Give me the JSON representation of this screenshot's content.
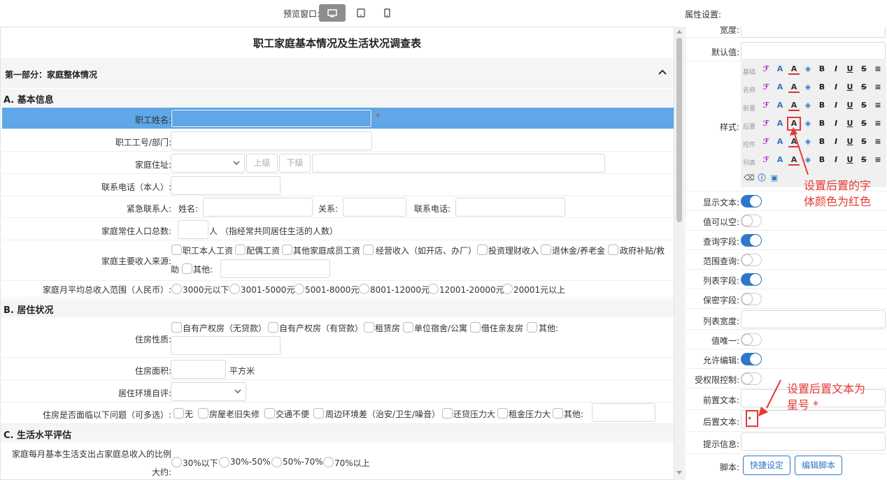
{
  "topbar": {
    "preview_label": "预览窗口:",
    "properties_title": "属性设置:"
  },
  "form": {
    "title": "职工家庭基本情况及生活状况调查表",
    "section1_title": "第一部分：家庭整体情况",
    "groupA": "A. 基本信息",
    "name_label": "职工姓名:",
    "required_mark": "*",
    "id_dept_label": "职工工号/部门:",
    "address_label": "家庭住址:",
    "btn_up": "上级",
    "btn_down": "下级",
    "phone_label": "联系电话（本人）:",
    "emergency_label": "紧急联系人:",
    "em_name": "姓名:",
    "em_relation": "关系:",
    "em_phone": "联系电话:",
    "pop_label": "家庭常住人口总数:",
    "pop_suffix": "人 （指经常共同居住生活的人数）",
    "income_src_label": "家庭主要收入来源:",
    "income_src_options": [
      "职工本人工资",
      "配偶工资",
      "其他家庭成员工资",
      "经营收入（如开店、办厂）",
      "投资理财收入",
      "退休金/养老金",
      "政府补贴/救"
    ],
    "income_src_wrap": "助",
    "income_src_other": "其他:",
    "income_range_label": "家庭月平均总收入范围（人民币）:",
    "income_range_options": [
      "3000元以下",
      "3001-5000元",
      "5001-8000元",
      "8001-12000元",
      "12001-20000元",
      "20001元以上"
    ],
    "groupB": "B. 居住状况",
    "housing_label": "住房性质:",
    "housing_options": [
      "自有产权房（无贷款）",
      "自有产权房（有贷款）",
      "租赁房",
      "单位宿舍/公寓",
      "借住亲友房",
      "其他:"
    ],
    "area_label": "住房面积:",
    "area_suffix": "平方米",
    "env_label": "居住环境自评:",
    "problems_label": "住房是否面临以下问题（可多选）:",
    "problems_options": [
      "无",
      "房屋老旧失修",
      "交通不便",
      "周边环境差（治安/卫生/噪音）",
      "还贷压力大",
      "租金压力大",
      "其他:"
    ],
    "groupC": "C. 生活水平评估",
    "ratio_label_1": "家庭每月基本生活支出占家庭总收入的比例",
    "ratio_label_2": "大约:",
    "ratio_options": [
      "30%以下",
      "30%-50%",
      "50%-70%",
      "70%以上"
    ]
  },
  "props": {
    "width_label": "宽度:",
    "default_label": "默认值:",
    "style_label": "样式:",
    "style_rows": [
      "基础",
      "名称",
      "前置",
      "后置",
      "控件",
      "列表"
    ],
    "show_text_label": "显示文本:",
    "nullable_label": "值可以空:",
    "query_field_label": "查询字段:",
    "range_query_label": "范围查询:",
    "list_field_label": "列表字段:",
    "secret_field_label": "保密字段:",
    "list_width_label": "列表宽度:",
    "unique_label": "值唯一:",
    "editable_label": "允许编辑:",
    "perm_label": "受权限控制:",
    "prefix_label": "前置文本:",
    "suffix_label": "后置文本:",
    "suffix_value": "*",
    "hint_label": "提示信息:",
    "script_label": "脚本:",
    "btn_quick": "快捷设定",
    "btn_edit_script": "编辑脚本",
    "toggles": {
      "show_text": true,
      "nullable": false,
      "query_field": true,
      "range_query": false,
      "list_field": true,
      "secret_field": false,
      "unique": false,
      "editable": true,
      "perm": false
    }
  },
  "annotations": {
    "a1_line1": "设置后置的字",
    "a1_line2": "体颜色为红色",
    "a2_line1": "设置后置文本为",
    "a2_line2": "星号 *"
  },
  "colors": {
    "accent": "#2e78c9",
    "selected_row": "#5fa7e6",
    "annotation": "#e53935"
  }
}
